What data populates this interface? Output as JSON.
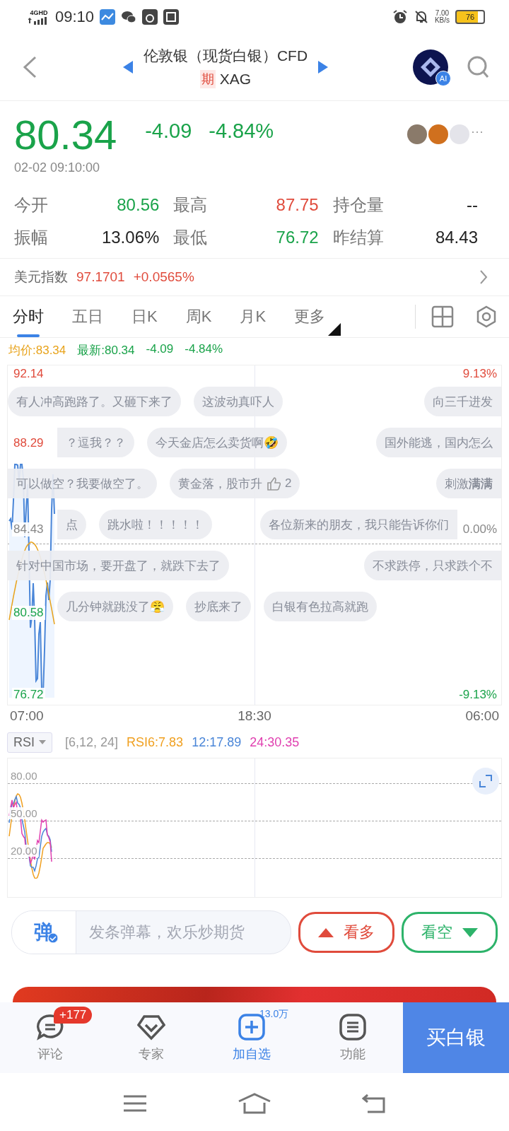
{
  "status_bar": {
    "network": "4GHD",
    "time": "09:10",
    "speed": "7.00",
    "speed_unit": "KB/s",
    "battery": "76"
  },
  "header": {
    "title": "伦敦银（现货白银）CFD",
    "badge": "期",
    "symbol": "XAG",
    "ai_badge": "AI"
  },
  "quote": {
    "price": "80.34",
    "change": "-4.09",
    "change_pct": "-4.84%",
    "timestamp": "02-02 09:10:00",
    "more": "···"
  },
  "stats": [
    {
      "label": "今开",
      "value": "80.56",
      "color": "#1aa34a"
    },
    {
      "label": "最高",
      "value": "87.75",
      "color": "#e04b3c"
    },
    {
      "label": "持仓量",
      "value": "--",
      "color": "#222222"
    },
    {
      "label": "振幅",
      "value": "13.06%",
      "color": "#222222"
    },
    {
      "label": "最低",
      "value": "76.72",
      "color": "#1aa34a"
    },
    {
      "label": "昨结算",
      "value": "84.43",
      "color": "#222222"
    }
  ],
  "index": {
    "name": "美元指数",
    "value": "97.1701",
    "change": "+0.0565%"
  },
  "tabs": [
    {
      "label": "分时",
      "selected": true
    },
    {
      "label": "五日",
      "selected": false
    },
    {
      "label": "日K",
      "selected": false
    },
    {
      "label": "周K",
      "selected": false
    },
    {
      "label": "月K",
      "selected": false
    },
    {
      "label": "更多",
      "selected": false,
      "kind": "menu"
    }
  ],
  "info": [
    {
      "text": "均价:83.34",
      "color": "#e8a31c"
    },
    {
      "text": "最新:80.34",
      "color": "#1aa34a"
    },
    {
      "text": "-4.09",
      "color": "#1aa34a"
    },
    {
      "text": "-4.84%",
      "color": "#1aa34a"
    }
  ],
  "chart": {
    "left_labels": [
      {
        "text": "92.14",
        "color": "#e04b3c"
      },
      {
        "text": "88.29",
        "color": "#e04b3c"
      },
      {
        "text": "84.43",
        "color": "#888888"
      },
      {
        "text": "80.58",
        "color": "#1aa34a"
      },
      {
        "text": "76.72",
        "color": "#1aa34a"
      }
    ],
    "right_labels": [
      {
        "text": "9.13%",
        "color": "#e04b3c"
      },
      {
        "text": "0.00%",
        "color": "#888888"
      },
      {
        "text": "-9.13%",
        "color": "#1aa34a"
      }
    ],
    "time_axis": [
      "07:00",
      "18:30",
      "06:00"
    ]
  },
  "danmaku": [
    {
      "bubbles": [
        {
          "text": "有人冲高跑路了。又砸下来了",
          "clipped": false
        },
        {
          "text": "这波动真吓人",
          "clipped": false
        },
        {
          "text": "向三千进发",
          "clipped": true
        }
      ]
    },
    {
      "bubbles": [
        {
          "text": "？逗我？？",
          "clipped": true
        },
        {
          "text": "今天金店怎么卖货啊🤣",
          "clipped": false
        },
        {
          "text": "国外能逃，国内怎么",
          "clipped": true
        }
      ]
    },
    {
      "bubbles": [
        {
          "text": "可以做空？我要做空了。",
          "clipped": true
        },
        {
          "text": "黄金落，股市升",
          "likes": "2",
          "clipped": false
        },
        {
          "text": "刺激**满满**",
          "clipped": true
        }
      ]
    },
    {
      "bubbles": [
        {
          "text": "点",
          "clipped": true
        },
        {
          "text": "跳水啦！！！！！",
          "clipped": false
        },
        {
          "text": "各位新来的朋友，我只能告诉你们",
          "clipped": true
        }
      ]
    },
    {
      "bubbles": [
        {
          "text": "针对中国市场，要开盘了，就跌下去了",
          "clipped": true
        },
        {
          "text": "不求跌停，只求跌个不",
          "clipped": true
        }
      ]
    },
    {
      "bubbles": [
        {
          "text": "几分钟就跳没了😤",
          "clipped": false
        },
        {
          "text": "抄底来了",
          "clipped": false
        },
        {
          "text": "白银有色拉高就跑",
          "clipped": false
        }
      ]
    }
  ],
  "rsi": {
    "selector": "RSI",
    "params": "[6,12, 24]",
    "values": [
      {
        "text": "RSI6:7.83",
        "color": "#f0a020"
      },
      {
        "text": "12:17.89",
        "color": "#4a86d8"
      },
      {
        "text": "24:30.35",
        "color": "#e040b0"
      }
    ],
    "levels": [
      "80.00",
      "50.00",
      "20.00"
    ]
  },
  "composer": {
    "icon_text": "弹",
    "placeholder": "发条弹幕，欢乐炒期货",
    "bull": "看多",
    "bear": "看空"
  },
  "bottom_nav": {
    "items": [
      {
        "label": "评论",
        "badge": "+177",
        "selected": false,
        "kind": "comment"
      },
      {
        "label": "专家",
        "selected": false,
        "kind": "expert"
      },
      {
        "label": "加自选",
        "count": "13.0万",
        "selected": true,
        "kind": "add"
      },
      {
        "label": "功能",
        "selected": false,
        "kind": "menu"
      }
    ],
    "buy": "买白银"
  }
}
